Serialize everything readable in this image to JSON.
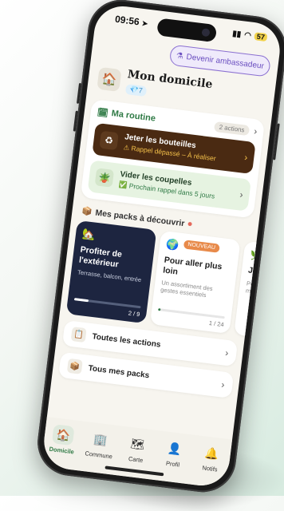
{
  "status": {
    "time": "09:56",
    "location_icon": "location-arrow-icon",
    "battery": "57"
  },
  "ambassador": {
    "label": "Devenir ambassadeur",
    "icon": "flask-icon"
  },
  "home": {
    "title": "Mon domicile",
    "points": "7",
    "icon": "house-icon"
  },
  "routine": {
    "title": "Ma routine",
    "actions_count": "2 actions",
    "tasks": [
      {
        "title": "Jeter les bouteilles",
        "subtitle": "Rappel dépassé – À réaliser",
        "icon": "recycle-icon",
        "status": "overdue"
      },
      {
        "title": "Vider les coupelles",
        "subtitle": "Prochain rappel dans 5 jours",
        "icon": "plant-icon",
        "status": "ok"
      }
    ]
  },
  "packs": {
    "title": "Mes packs à découvrir",
    "items": [
      {
        "title": "Profiter de l'extérieur",
        "desc": "Terrasse, balcon, entrée",
        "progress": "2 / 9",
        "progress_fraction": 0.22
      },
      {
        "title": "Pour aller plus loin",
        "desc": "Un assortiment des gestes essentiels",
        "progress": "1 / 24",
        "progress_fraction": 0.04,
        "badge": "NOUVEAU"
      },
      {
        "title": "Jar",
        "desc": "Pota mass"
      }
    ]
  },
  "lists": [
    {
      "label": "Toutes les actions",
      "icon": "checklist-icon"
    },
    {
      "label": "Tous mes packs",
      "icon": "box-icon"
    }
  ],
  "tabs": [
    {
      "label": "Domicile",
      "icon": "house-icon",
      "active": true
    },
    {
      "label": "Commune",
      "icon": "building-icon"
    },
    {
      "label": "Carte",
      "icon": "map-icon"
    },
    {
      "label": "Profil",
      "icon": "user-icon"
    },
    {
      "label": "Notifs",
      "icon": "bell-icon"
    }
  ]
}
